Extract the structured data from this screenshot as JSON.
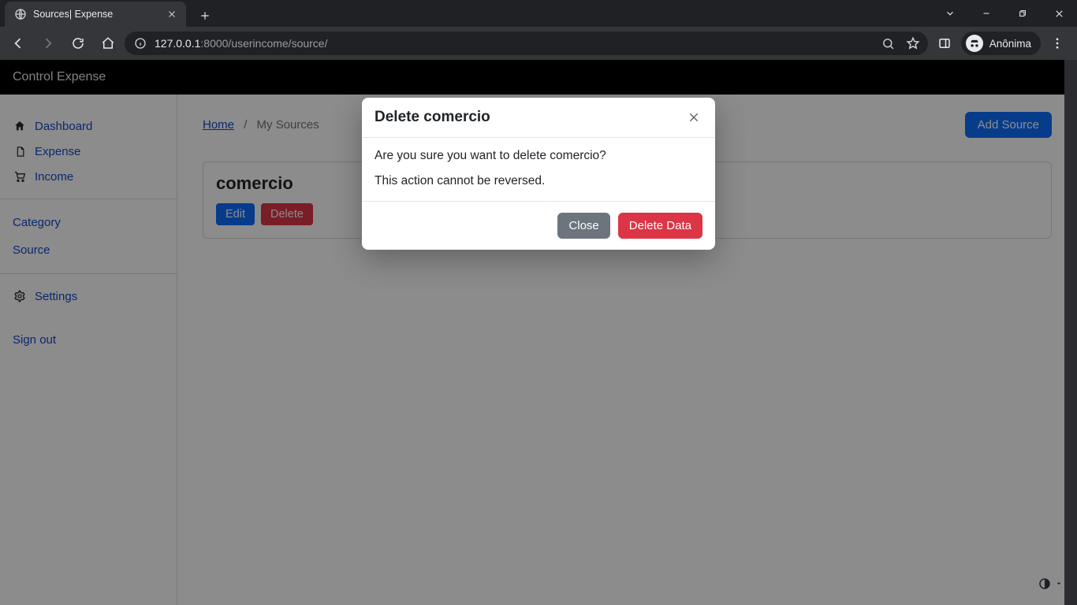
{
  "browser": {
    "tab_title": "Sources| Expense",
    "url_host": "127.0.0.1",
    "url_port_path": ":8000/userincome/source/",
    "profile_label": "Anônima"
  },
  "navbar": {
    "brand": "Control Expense"
  },
  "sidebar": {
    "items": [
      {
        "label": "Dashboard"
      },
      {
        "label": "Expense"
      },
      {
        "label": "Income"
      }
    ],
    "secondary": [
      {
        "label": "Category"
      },
      {
        "label": "Source"
      }
    ],
    "settings_label": "Settings",
    "signout_label": "Sign out"
  },
  "breadcrumb": {
    "home": "Home",
    "current": "My Sources"
  },
  "add_button": "Add Source",
  "card": {
    "title": "comercio",
    "edit_label": "Edit",
    "delete_label": "Delete"
  },
  "modal": {
    "title": "Delete comercio",
    "line1": "Are you sure you want to delete comercio?",
    "line2": "This action cannot be reversed.",
    "close_label": "Close",
    "confirm_label": "Delete Data"
  }
}
